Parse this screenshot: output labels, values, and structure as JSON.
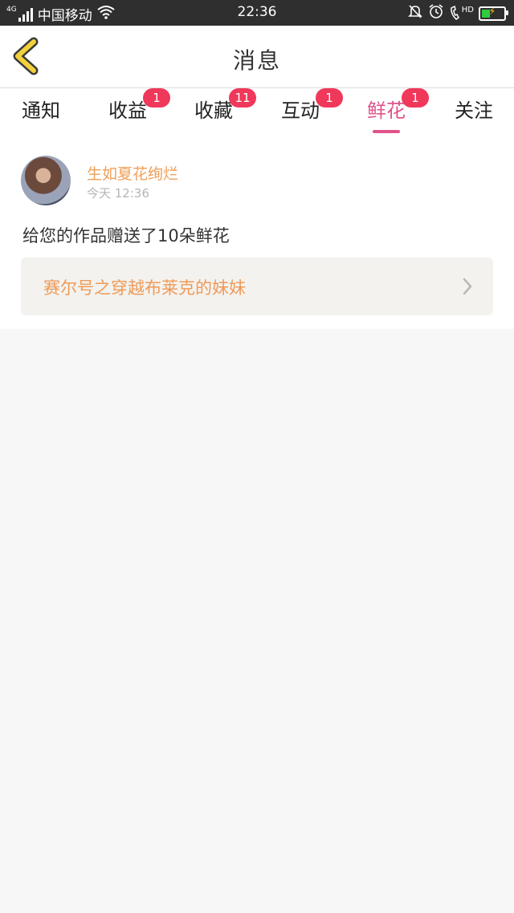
{
  "status_bar": {
    "network": "4G",
    "carrier": "中国移动",
    "time": "22:36",
    "hd": "HD",
    "battery_level": 0.45,
    "battery_color": "#2ecc40"
  },
  "header": {
    "title": "消息",
    "back_icon": "chevron-left-icon",
    "back_color": "#f2d13b"
  },
  "tabs": [
    {
      "label": "通知",
      "badge": ""
    },
    {
      "label": "收益",
      "badge": "1"
    },
    {
      "label": "收藏",
      "badge": "11"
    },
    {
      "label": "互动",
      "badge": "1"
    },
    {
      "label": "鲜花",
      "badge": "1",
      "active": true
    },
    {
      "label": "关注",
      "badge": ""
    }
  ],
  "message": {
    "sender": "生如夏花绚烂",
    "time": "今天 12:36",
    "text": "给您的作品赠送了10朵鲜花",
    "work_title": "赛尔号之穿越布莱克的妹妹"
  },
  "colors": {
    "accent": "#e0538a",
    "badge": "#f0385a",
    "sender": "#f0a05a"
  }
}
